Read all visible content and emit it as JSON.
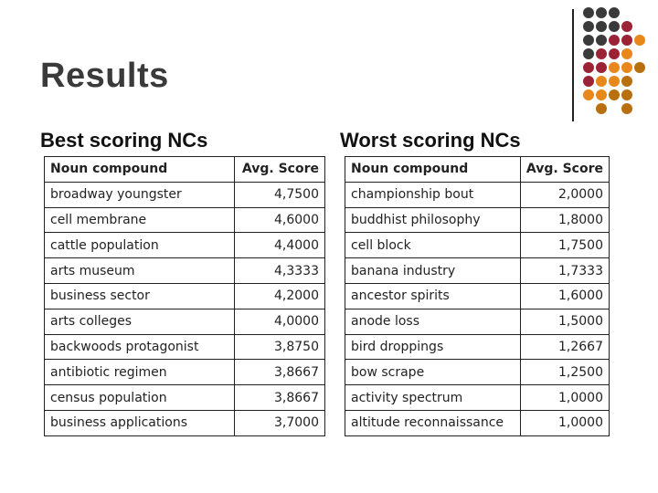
{
  "slide": {
    "title": "Results",
    "best": {
      "heading": "Best scoring NCs",
      "columns": [
        "Noun compound",
        "Avg. Score"
      ],
      "rows": [
        {
          "compound": "broadway youngster",
          "score": "4,7500"
        },
        {
          "compound": "cell membrane",
          "score": "4,6000"
        },
        {
          "compound": "cattle population",
          "score": "4,4000"
        },
        {
          "compound": "arts museum",
          "score": "4,3333"
        },
        {
          "compound": "business sector",
          "score": "4,2000"
        },
        {
          "compound": "arts colleges",
          "score": "4,0000"
        },
        {
          "compound": "backwoods protagonist",
          "score": "3,8750"
        },
        {
          "compound": "antibiotic regimen",
          "score": "3,8667"
        },
        {
          "compound": "census population",
          "score": "3,8667"
        },
        {
          "compound": "business applications",
          "score": "3,7000"
        }
      ]
    },
    "worst": {
      "heading": "Worst scoring NCs",
      "columns": [
        "Noun compound",
        "Avg. Score"
      ],
      "rows": [
        {
          "compound": "championship bout",
          "score": "2,0000"
        },
        {
          "compound": "buddhist philosophy",
          "score": "1,8000"
        },
        {
          "compound": "cell block",
          "score": "1,7500"
        },
        {
          "compound": "banana industry",
          "score": "1,7333"
        },
        {
          "compound": "ancestor spirits",
          "score": "1,6000"
        },
        {
          "compound": "anode loss",
          "score": "1,5000"
        },
        {
          "compound": "bird droppings",
          "score": "1,2667"
        },
        {
          "compound": "bow scrape",
          "score": "1,2500"
        },
        {
          "compound": "activity spectrum",
          "score": "1,0000"
        },
        {
          "compound": "altitude reconnaissance",
          "score": "1,0000"
        }
      ]
    }
  },
  "decoration": {
    "colors": {
      "dark": "#3a3a3a",
      "red": "#9b2335",
      "orange": "#e8881a",
      "brown": "#b8700f"
    },
    "dot_grid": [
      [
        "dark",
        "dark",
        "dark"
      ],
      [
        "dark",
        "dark",
        "dark",
        "red"
      ],
      [
        "dark",
        "dark",
        "red",
        "red",
        "orange"
      ],
      [
        "dark",
        "red",
        "red",
        "orange"
      ],
      [
        "red",
        "red",
        "orange",
        "orange",
        "brown"
      ],
      [
        "red",
        "orange",
        "orange",
        "brown"
      ],
      [
        "orange",
        "orange",
        "brown",
        "brown"
      ],
      [
        null,
        "brown",
        null,
        "brown"
      ]
    ]
  }
}
